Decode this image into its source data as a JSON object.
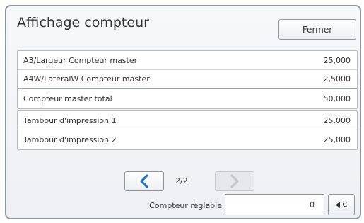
{
  "header": {
    "title": "Affichage compteur",
    "close_label": "Fermer"
  },
  "counters": {
    "group1": [
      {
        "label": "A3/Largeur Compteur master",
        "value": "25,000"
      },
      {
        "label": "A4W/LatéralW Compteur master",
        "value": "2,5000"
      },
      {
        "label": "Compteur master total",
        "value": "50,000"
      }
    ],
    "group2": [
      {
        "label": "Tambour d'impression 1",
        "value": "25,000"
      },
      {
        "label": "Tambour d'impression 2",
        "value": "25,000"
      }
    ]
  },
  "pager": {
    "indicator": "2/2",
    "prev_icon": "chevron-left-icon",
    "next_icon": "chevron-right-icon"
  },
  "adjustable": {
    "label": "Compteur réglable",
    "value": "0",
    "clear_label": "C",
    "clear_icon": "triangle-left-icon"
  },
  "colors": {
    "accent": "#2a74c8",
    "disabled": "#b9bec4"
  }
}
